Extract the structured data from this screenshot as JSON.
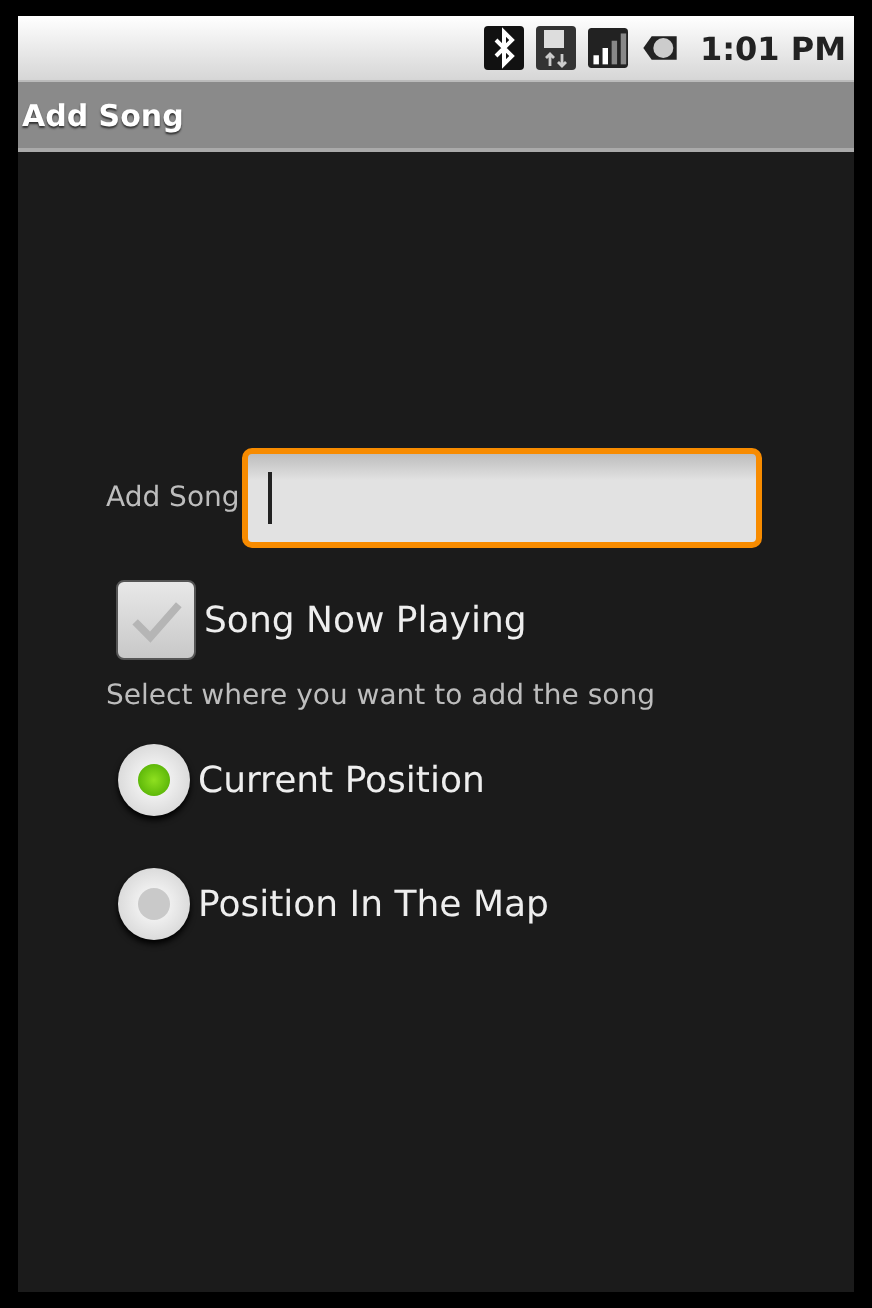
{
  "status_bar": {
    "time": "1:01 PM"
  },
  "window": {
    "title": "Add Song"
  },
  "song_field": {
    "label": "Add Song",
    "focused": true
  },
  "checkbox": {
    "label": "Song Now Playing",
    "checked": false
  },
  "prompt": "Select where you want to add the song",
  "radios": [
    {
      "label": "Current Position",
      "selected": true
    },
    {
      "label": "Position In The Map",
      "selected": false
    }
  ]
}
